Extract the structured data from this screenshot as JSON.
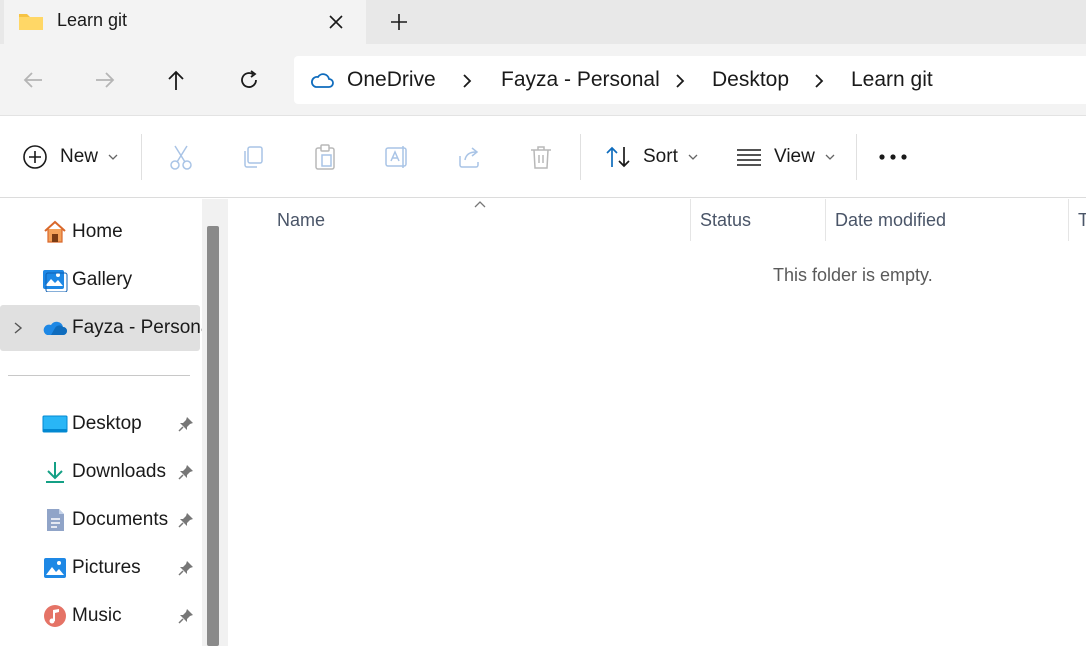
{
  "tab": {
    "title": "Learn git"
  },
  "breadcrumbs": [
    "OneDrive",
    "Fayza - Personal",
    "Desktop",
    "Learn git"
  ],
  "command_bar": {
    "new_label": "New",
    "sort_label": "Sort",
    "view_label": "View"
  },
  "sidebar": {
    "items": [
      {
        "label": "Home",
        "icon": "home-icon",
        "pinned": false
      },
      {
        "label": "Gallery",
        "icon": "gallery-icon",
        "pinned": false
      },
      {
        "label": "Fayza - Personal",
        "icon": "onedrive-cloud-icon",
        "pinned": false,
        "selected": true,
        "expandable": true
      }
    ],
    "quick_access": [
      {
        "label": "Desktop",
        "icon": "desktop-icon",
        "pinned": true
      },
      {
        "label": "Downloads",
        "icon": "downloads-icon",
        "pinned": true
      },
      {
        "label": "Documents",
        "icon": "documents-icon",
        "pinned": true
      },
      {
        "label": "Pictures",
        "icon": "pictures-icon",
        "pinned": true
      },
      {
        "label": "Music",
        "icon": "music-icon",
        "pinned": true
      }
    ]
  },
  "columns": [
    "Name",
    "Status",
    "Date modified",
    "T"
  ],
  "empty_message": "This folder is empty.",
  "colors": {
    "accent": "#0f6cbd",
    "folder_yellow": "#f6c343",
    "selection": "#e0e0e0"
  }
}
